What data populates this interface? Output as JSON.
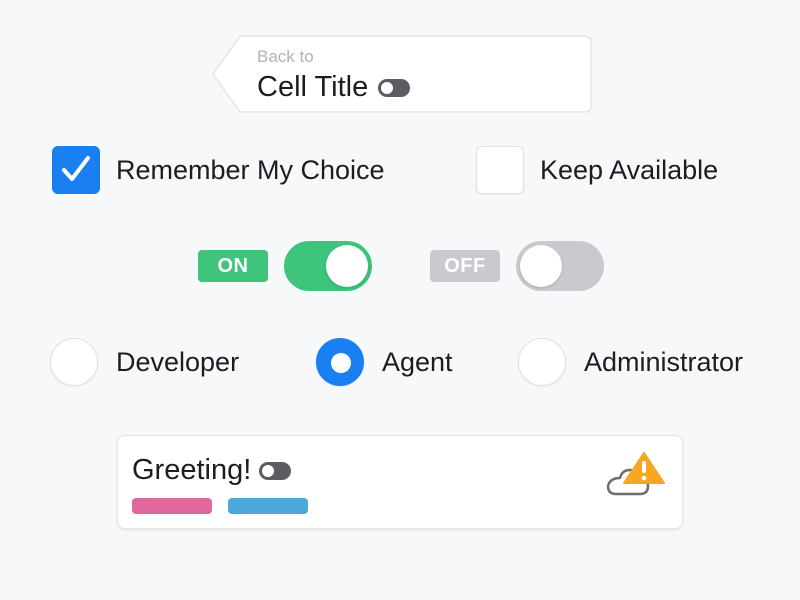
{
  "back_button": {
    "subtitle": "Back to",
    "title": "Cell Title"
  },
  "checkboxes": [
    {
      "label": "Remember My Choice",
      "checked": true
    },
    {
      "label": "Keep Available",
      "checked": false
    }
  ],
  "toggles": [
    {
      "tag": "ON",
      "state": "on"
    },
    {
      "tag": "OFF",
      "state": "off"
    }
  ],
  "radios": [
    {
      "label": "Developer",
      "selected": false
    },
    {
      "label": "Agent",
      "selected": true
    },
    {
      "label": "Administrator",
      "selected": false
    }
  ],
  "card": {
    "title": "Greeting!",
    "tags": [
      "pink",
      "blue"
    ],
    "status_icon": "cloud-warning-icon"
  },
  "colors": {
    "accent_blue": "#1a7ff0",
    "on_green": "#3ec47b",
    "off_gray": "#c9cacf",
    "warning_orange": "#f5a623",
    "tag_pink": "#e0669e",
    "tag_blue": "#4ba7dc"
  }
}
